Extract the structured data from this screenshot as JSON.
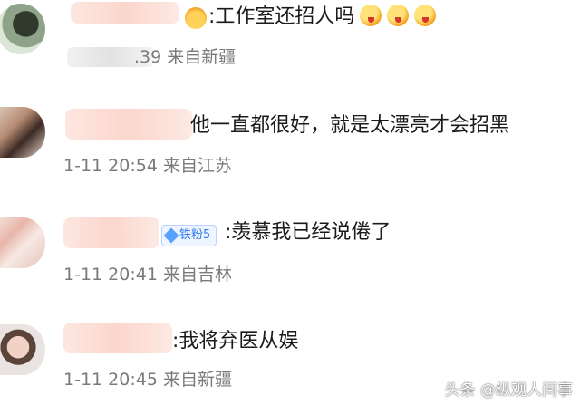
{
  "comments": [
    {
      "content": ":工作室还招人吗",
      "time": ".39",
      "location": "来自新疆"
    },
    {
      "content": "他一直都很好，就是太漂亮才会招黑",
      "time": "1-11 20:54",
      "location": "来自江苏"
    },
    {
      "badge": "铁粉5",
      "content": ":羡慕我已经说倦了",
      "time": "1-11 20:41",
      "location": "来自吉林"
    },
    {
      "content": ":我将弃医从娱",
      "time": "1-11 20:45",
      "location": "来自新疆"
    }
  ],
  "watermark": "头条 @纵观人间事"
}
